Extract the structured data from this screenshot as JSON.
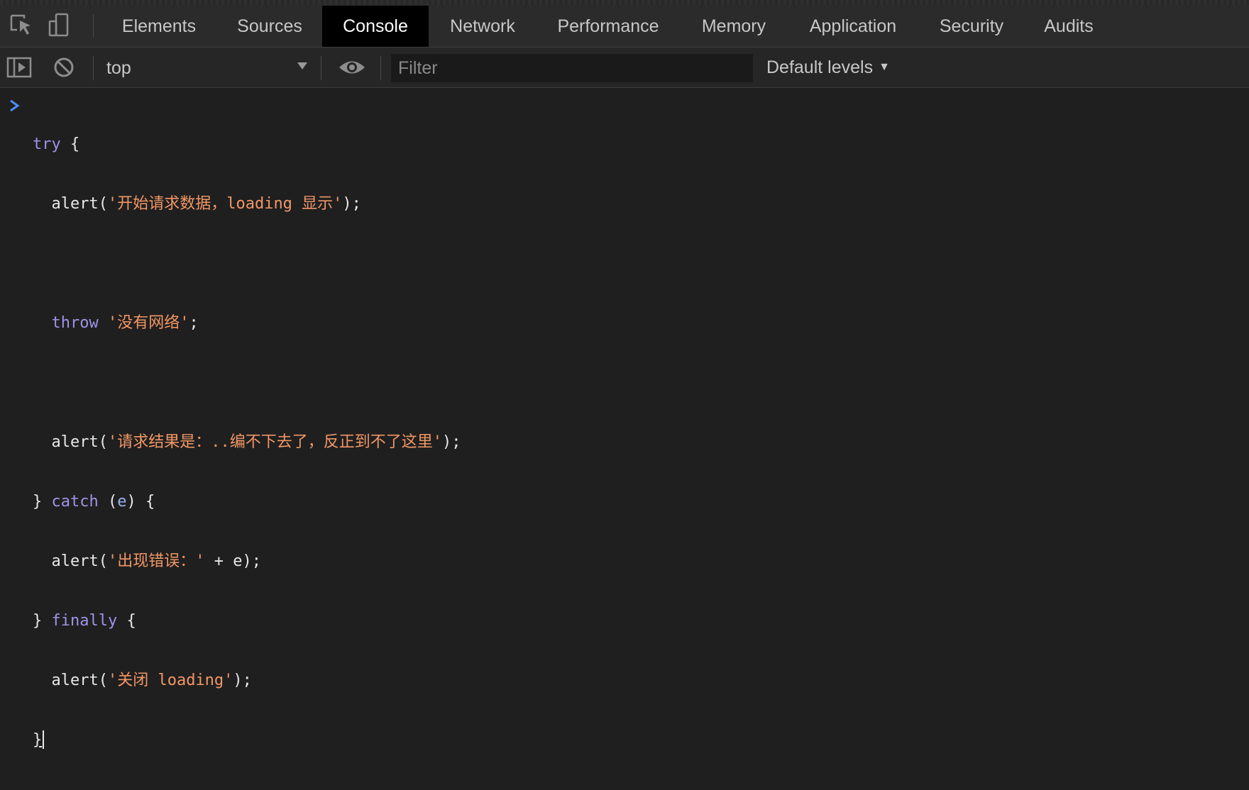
{
  "tabs": [
    {
      "label": "Elements",
      "active": false
    },
    {
      "label": "Sources",
      "active": false
    },
    {
      "label": "Console",
      "active": true
    },
    {
      "label": "Network",
      "active": false
    },
    {
      "label": "Performance",
      "active": false
    },
    {
      "label": "Memory",
      "active": false
    },
    {
      "label": "Application",
      "active": false
    },
    {
      "label": "Security",
      "active": false
    },
    {
      "label": "Audits",
      "active": false
    }
  ],
  "toolbar": {
    "context": "top",
    "filter_placeholder": "Filter",
    "levels": "Default levels"
  },
  "icons": {
    "inspect": "inspect-element-icon",
    "device": "device-toolbar-icon",
    "sidebar": "show-console-sidebar-icon",
    "clear": "clear-console-icon",
    "eye": "live-expression-eye-icon",
    "prompt": "console-prompt-chevron-icon"
  },
  "colors": {
    "background": "#1f1f1f",
    "active_tab": "#000000",
    "keyword": "#9e93e8",
    "string": "#f29766",
    "prompt": "#4d8ef7"
  },
  "console": {
    "lines": [
      [
        "try",
        " {"
      ],
      [
        "  alert(",
        "'开始请求数据，loading 显示'",
        ");"
      ],
      [
        ""
      ],
      [
        "  ",
        "throw",
        " ",
        "'没有网络'",
        ";"
      ],
      [
        ""
      ],
      [
        "  alert(",
        "'请求结果是：..编不下去了，反正到不了这里'",
        ");"
      ],
      [
        "} ",
        "catch",
        " (",
        "e",
        ") {"
      ],
      [
        "  alert(",
        "'出现错误：'",
        " + e);"
      ],
      [
        "} ",
        "finally",
        " {"
      ],
      [
        "  alert(",
        "'关闭 loading'",
        ");"
      ],
      [
        "}"
      ]
    ]
  }
}
